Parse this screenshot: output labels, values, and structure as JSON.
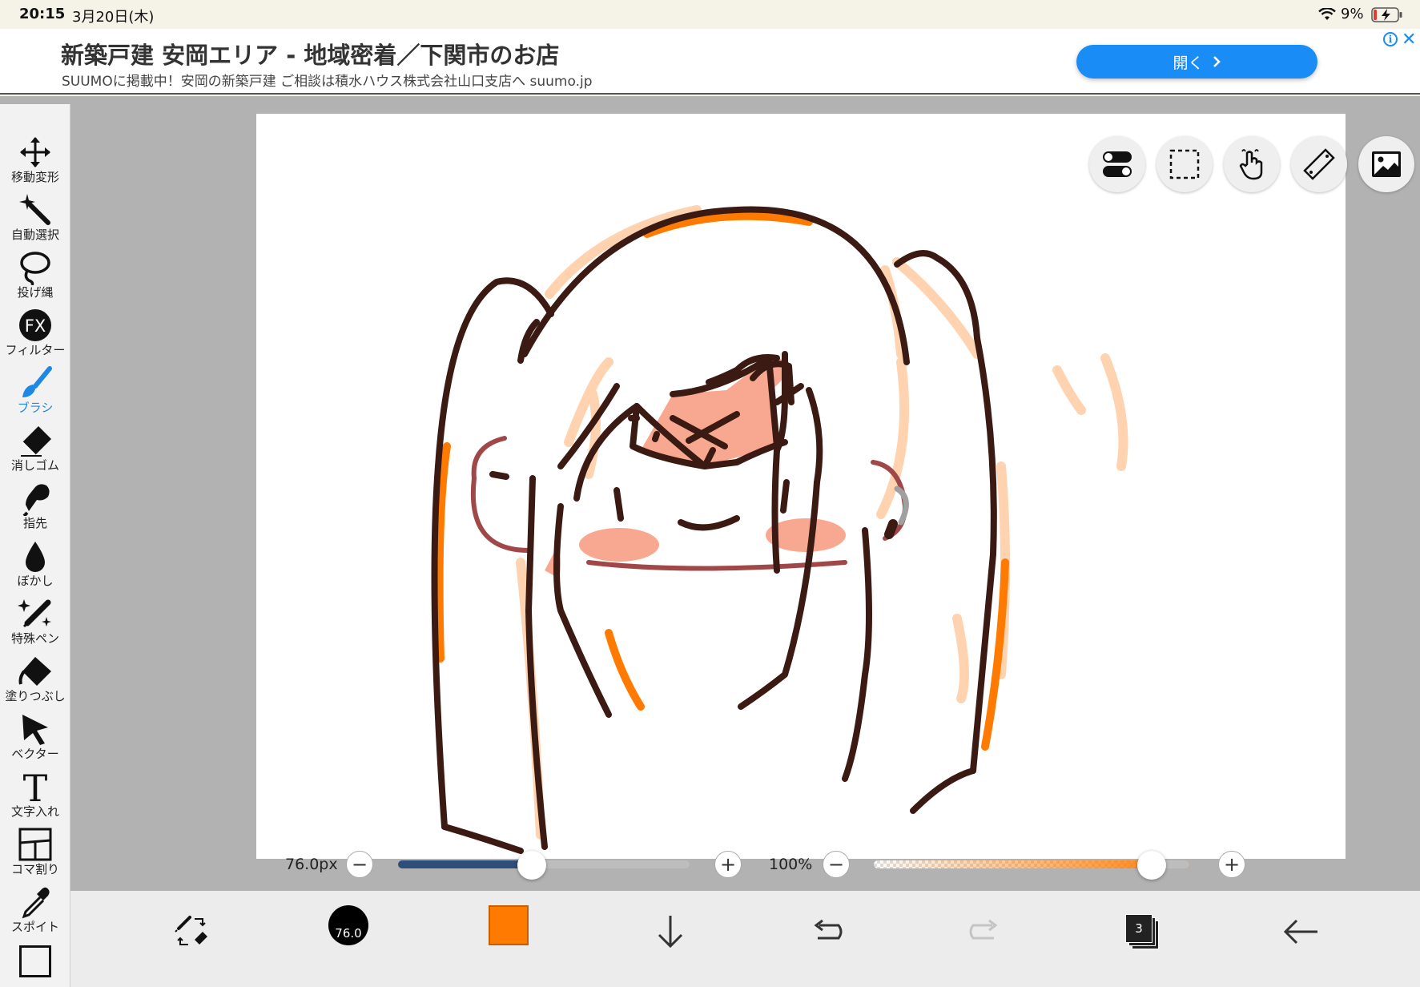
{
  "status": {
    "time": "20:15",
    "date": "3月20日(木)",
    "battery_pct": "9%"
  },
  "ad": {
    "title": "新築戸建 安岡エリア - 地域密着／下関市のお店",
    "subtitle": "SUUMOに掲載中！安岡の新築戸建 ご相談は積水ハウス株式会社山口支店へ suumo.jp",
    "button_label": "開く",
    "info_glyph": "i",
    "close_glyph": "✕"
  },
  "tools": [
    {
      "label": "移動変形",
      "icon": "move-icon"
    },
    {
      "label": "自動選択",
      "icon": "magic-wand-icon"
    },
    {
      "label": "投げ縄",
      "icon": "lasso-icon"
    },
    {
      "label": "フィルター",
      "icon": "fx-icon"
    },
    {
      "label": "ブラシ",
      "icon": "brush-icon",
      "active": true
    },
    {
      "label": "消しゴム",
      "icon": "eraser-icon"
    },
    {
      "label": "指先",
      "icon": "finger-icon"
    },
    {
      "label": "ぼかし",
      "icon": "blur-drop-icon"
    },
    {
      "label": "特殊ペン",
      "icon": "special-pen-icon"
    },
    {
      "label": "塗りつぶし",
      "icon": "fill-bucket-icon"
    },
    {
      "label": "ベクター",
      "icon": "vector-cursor-icon"
    },
    {
      "label": "文字入れ",
      "icon": "text-icon"
    },
    {
      "label": "コマ割り",
      "icon": "panel-icon"
    },
    {
      "label": "スポイト",
      "icon": "eyedropper-icon"
    }
  ],
  "fx_glyph": "FX",
  "text_glyph": "T",
  "sliders": {
    "size_label": "76.0px",
    "size_fraction": 0.46,
    "opacity_label": "100%",
    "opacity_fraction": 0.88,
    "minus_glyph": "−",
    "plus_glyph": "+"
  },
  "bottom": {
    "brush_size": "76.0",
    "color": "#ff7a00",
    "layer_count": "3"
  },
  "colors": {
    "accent_blue": "#1a8cf5",
    "outline": "#3a1a12",
    "orange": "#ff7a00",
    "peach": "#ffd2b0",
    "blush": "#f8a890",
    "ear_red": "#a04848"
  }
}
